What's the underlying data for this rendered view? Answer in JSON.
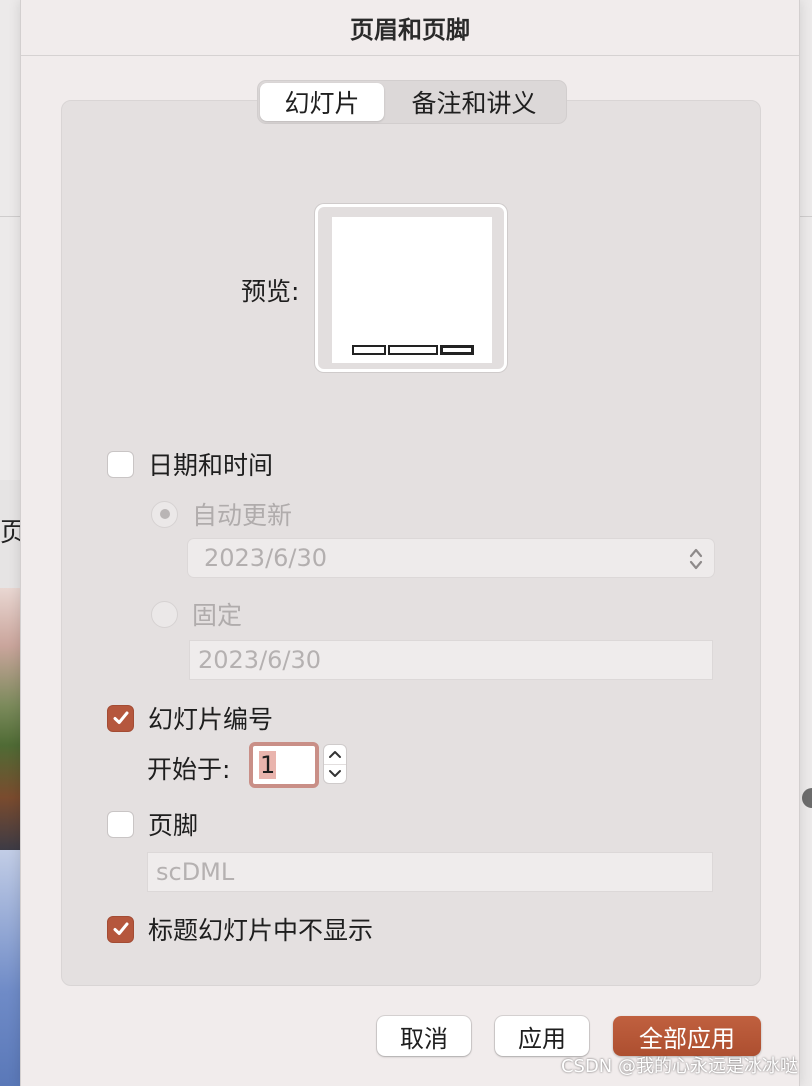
{
  "dialog": {
    "title": "页眉和页脚",
    "tabs": [
      {
        "label": "幻灯片",
        "active": true
      },
      {
        "label": "备注和讲义",
        "active": false
      }
    ],
    "preview_label": "预览:"
  },
  "options": {
    "date_time": {
      "label": "日期和时间",
      "checked": false
    },
    "auto_update": {
      "label": "自动更新",
      "selected": true,
      "enabled": false
    },
    "date_format_value": "2023/6/30",
    "fixed": {
      "label": "固定",
      "selected": false,
      "enabled": false
    },
    "fixed_value": "2023/6/30",
    "slide_number": {
      "label": "幻灯片编号",
      "checked": true
    },
    "start_at_label": "开始于:",
    "start_at_value": "1",
    "footer": {
      "label": "页脚",
      "checked": false
    },
    "footer_value": "scDML",
    "hide_on_title": {
      "label": "标题幻灯片中不显示",
      "checked": true
    }
  },
  "buttons": {
    "cancel": "取消",
    "apply": "应用",
    "apply_all": "全部应用"
  },
  "background": {
    "left_text": "页",
    "watermark": "CSDN @我的心永远是冰冰哒"
  },
  "colors": {
    "accent": "#b5573d",
    "sheet": "#f1ecec",
    "panel": "#e4e0e0"
  }
}
